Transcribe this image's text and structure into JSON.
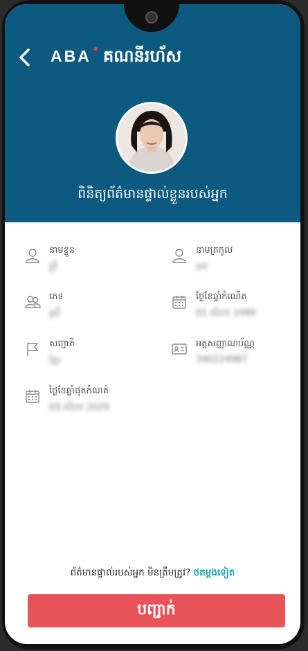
{
  "header": {
    "brand": "ABA",
    "title": "គណនីរហ័ស",
    "subtitle": "ពិនិត្យព័ត៌មានផ្ទាល់ខ្លួនរបស់អ្នក"
  },
  "fields": {
    "first_name": {
      "label": "នាមខ្លួន",
      "value": "ប្រី"
    },
    "last_name": {
      "label": "នាមត្រកូល",
      "value": "ឆាវ"
    },
    "gender": {
      "label": "ភេទ",
      "value": "ស្រី"
    },
    "dob": {
      "label": "ថ្ងៃខែឆ្នាំកំណើត",
      "value": "01 សីហា 1999"
    },
    "nationality": {
      "label": "សញ្ជាតិ",
      "value": "ខ្មែរ"
    },
    "id_number": {
      "label": "អត្តសញ្ញាណប័ណ្ណ",
      "value": "340224987"
    },
    "expiry": {
      "label": "ថ្ងៃខែឆ្នាំផុតកំណត់",
      "value": "03 សីហា 2029"
    }
  },
  "footer": {
    "question": "ព័ត៌មានផ្ទាល់របស់អ្នក មិនត្រឹមត្រូវ?",
    "retry_link": "ថតម្តងទៀត",
    "confirm_label": "បញ្ជាក់"
  },
  "colors": {
    "header_bg": "#0c5a80",
    "accent": "#e8535a",
    "link": "#1aa9b3"
  },
  "icons": [
    "back-arrow-icon",
    "user-icon",
    "users-icon",
    "calendar-icon",
    "flag-icon",
    "id-card-icon"
  ]
}
